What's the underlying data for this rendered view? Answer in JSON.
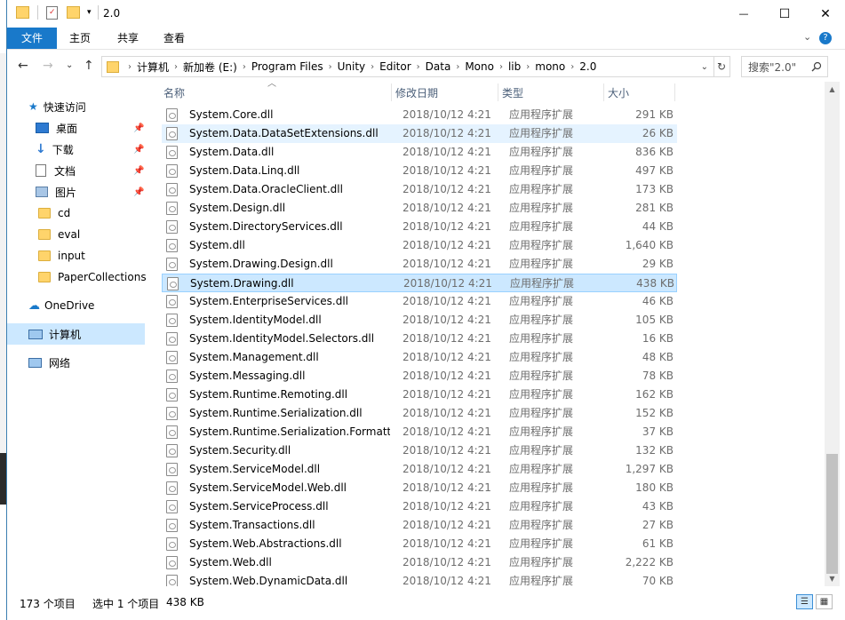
{
  "window": {
    "title": "2.0",
    "minimize": "—",
    "maximize": "☐",
    "close": "✕"
  },
  "ribbon": {
    "tabs": [
      "文件",
      "主页",
      "共享",
      "查看"
    ],
    "expand": "⌄",
    "help": "?"
  },
  "nav": {
    "back": "←",
    "forward": "→",
    "recent": "⌄",
    "up": "↑"
  },
  "address": {
    "crumbs": [
      "计算机",
      "新加卷 (E:)",
      "Program Files",
      "Unity",
      "Editor",
      "Data",
      "Mono",
      "lib",
      "mono",
      "2.0"
    ],
    "dropdown": "⌄",
    "refresh": "↻"
  },
  "search": {
    "placeholder": "搜索\"2.0\"",
    "icon": "search-icon"
  },
  "sidebar": {
    "quick_access": "快速访问",
    "items": [
      {
        "label": "桌面",
        "pinned": true
      },
      {
        "label": "下载",
        "pinned": true
      },
      {
        "label": "文档",
        "pinned": true
      },
      {
        "label": "图片",
        "pinned": true
      },
      {
        "label": "cd",
        "pinned": false
      },
      {
        "label": "eval",
        "pinned": false
      },
      {
        "label": "input",
        "pinned": false
      },
      {
        "label": "PaperCollections",
        "pinned": false
      }
    ],
    "onedrive": "OneDrive",
    "computer": "计算机",
    "network": "网络",
    "pin_glyph": "📌"
  },
  "columns": {
    "name": "名称",
    "date": "修改日期",
    "type": "类型",
    "size": "大小",
    "sort_glyph": "︿"
  },
  "files": [
    {
      "name": "System.Core.dll",
      "date": "2018/10/12 4:21",
      "type": "应用程序扩展",
      "size": "291 KB"
    },
    {
      "name": "System.Data.DataSetExtensions.dll",
      "date": "2018/10/12 4:21",
      "type": "应用程序扩展",
      "size": "26 KB"
    },
    {
      "name": "System.Data.dll",
      "date": "2018/10/12 4:21",
      "type": "应用程序扩展",
      "size": "836 KB"
    },
    {
      "name": "System.Data.Linq.dll",
      "date": "2018/10/12 4:21",
      "type": "应用程序扩展",
      "size": "497 KB"
    },
    {
      "name": "System.Data.OracleClient.dll",
      "date": "2018/10/12 4:21",
      "type": "应用程序扩展",
      "size": "173 KB"
    },
    {
      "name": "System.Design.dll",
      "date": "2018/10/12 4:21",
      "type": "应用程序扩展",
      "size": "281 KB"
    },
    {
      "name": "System.DirectoryServices.dll",
      "date": "2018/10/12 4:21",
      "type": "应用程序扩展",
      "size": "44 KB"
    },
    {
      "name": "System.dll",
      "date": "2018/10/12 4:21",
      "type": "应用程序扩展",
      "size": "1,640 KB"
    },
    {
      "name": "System.Drawing.Design.dll",
      "date": "2018/10/12 4:21",
      "type": "应用程序扩展",
      "size": "29 KB"
    },
    {
      "name": "System.Drawing.dll",
      "date": "2018/10/12 4:21",
      "type": "应用程序扩展",
      "size": "438 KB"
    },
    {
      "name": "System.EnterpriseServices.dll",
      "date": "2018/10/12 4:21",
      "type": "应用程序扩展",
      "size": "46 KB"
    },
    {
      "name": "System.IdentityModel.dll",
      "date": "2018/10/12 4:21",
      "type": "应用程序扩展",
      "size": "105 KB"
    },
    {
      "name": "System.IdentityModel.Selectors.dll",
      "date": "2018/10/12 4:21",
      "type": "应用程序扩展",
      "size": "16 KB"
    },
    {
      "name": "System.Management.dll",
      "date": "2018/10/12 4:21",
      "type": "应用程序扩展",
      "size": "48 KB"
    },
    {
      "name": "System.Messaging.dll",
      "date": "2018/10/12 4:21",
      "type": "应用程序扩展",
      "size": "78 KB"
    },
    {
      "name": "System.Runtime.Remoting.dll",
      "date": "2018/10/12 4:21",
      "type": "应用程序扩展",
      "size": "162 KB"
    },
    {
      "name": "System.Runtime.Serialization.dll",
      "date": "2018/10/12 4:21",
      "type": "应用程序扩展",
      "size": "152 KB"
    },
    {
      "name": "System.Runtime.Serialization.Formatt...",
      "date": "2018/10/12 4:21",
      "type": "应用程序扩展",
      "size": "37 KB"
    },
    {
      "name": "System.Security.dll",
      "date": "2018/10/12 4:21",
      "type": "应用程序扩展",
      "size": "132 KB"
    },
    {
      "name": "System.ServiceModel.dll",
      "date": "2018/10/12 4:21",
      "type": "应用程序扩展",
      "size": "1,297 KB"
    },
    {
      "name": "System.ServiceModel.Web.dll",
      "date": "2018/10/12 4:21",
      "type": "应用程序扩展",
      "size": "180 KB"
    },
    {
      "name": "System.ServiceProcess.dll",
      "date": "2018/10/12 4:21",
      "type": "应用程序扩展",
      "size": "43 KB"
    },
    {
      "name": "System.Transactions.dll",
      "date": "2018/10/12 4:21",
      "type": "应用程序扩展",
      "size": "27 KB"
    },
    {
      "name": "System.Web.Abstractions.dll",
      "date": "2018/10/12 4:21",
      "type": "应用程序扩展",
      "size": "61 KB"
    },
    {
      "name": "System.Web.dll",
      "date": "2018/10/12 4:21",
      "type": "应用程序扩展",
      "size": "2,222 KB"
    },
    {
      "name": "System.Web.DynamicData.dll",
      "date": "2018/10/12 4:21",
      "type": "应用程序扩展",
      "size": "70 KB"
    }
  ],
  "hovered_index": 1,
  "selected_index": 9,
  "status": {
    "count": "173 个项目",
    "selection": "选中 1 个项目",
    "selection_size": "438 KB"
  },
  "colors": {
    "accent": "#1979ca",
    "selected": "#cce8ff",
    "hover": "#e5f3ff"
  }
}
